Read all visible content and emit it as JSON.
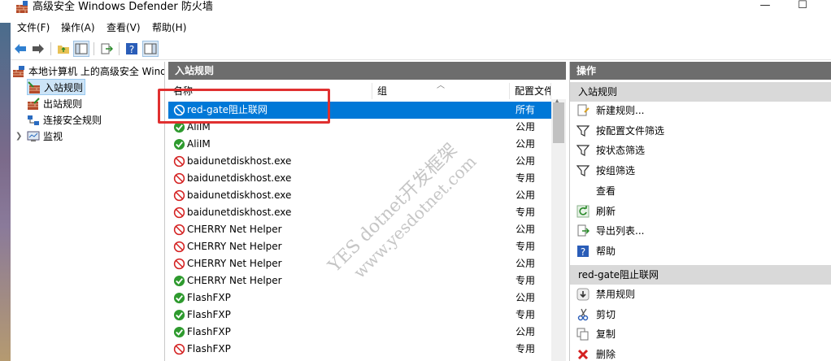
{
  "window": {
    "title": "高级安全 Windows Defender 防火墙",
    "minimize": "—",
    "maximize": "☐"
  },
  "menu": [
    "文件(F)",
    "操作(A)",
    "查看(V)",
    "帮助(H)"
  ],
  "tree": {
    "root": "本地计算机 上的高级安全 Wind",
    "items": [
      "入站规则",
      "出站规则",
      "连接安全规则",
      "监视"
    ]
  },
  "center": {
    "header": "入站规则",
    "columns": {
      "name": "名称",
      "group": "组",
      "profile": "配置文件"
    },
    "rows": [
      {
        "name": "red-gate阻止联网",
        "profile": "所有",
        "status": "blocked"
      },
      {
        "name": "AliIM",
        "profile": "公用",
        "status": "allowed"
      },
      {
        "name": "AliIM",
        "profile": "公用",
        "status": "allowed"
      },
      {
        "name": "baidunetdiskhost.exe",
        "profile": "公用",
        "status": "blocked"
      },
      {
        "name": "baidunetdiskhost.exe",
        "profile": "专用",
        "status": "blocked"
      },
      {
        "name": "baidunetdiskhost.exe",
        "profile": "公用",
        "status": "blocked"
      },
      {
        "name": "baidunetdiskhost.exe",
        "profile": "专用",
        "status": "blocked"
      },
      {
        "name": "CHERRY Net Helper",
        "profile": "公用",
        "status": "blocked"
      },
      {
        "name": "CHERRY Net Helper",
        "profile": "专用",
        "status": "blocked"
      },
      {
        "name": "CHERRY Net Helper",
        "profile": "公用",
        "status": "blocked"
      },
      {
        "name": "CHERRY Net Helper",
        "profile": "专用",
        "status": "allowed"
      },
      {
        "name": "FlashFXP",
        "profile": "公用",
        "status": "allowed"
      },
      {
        "name": "FlashFXP",
        "profile": "专用",
        "status": "allowed"
      },
      {
        "name": "FlashFXP",
        "profile": "公用",
        "status": "allowed"
      },
      {
        "name": "FlashFXP",
        "profile": "专用",
        "status": "blocked"
      }
    ]
  },
  "actions": {
    "header": "操作",
    "section1": "入站规则",
    "section1_items": [
      {
        "label": "新建规则...",
        "icon": "new-rule-icon"
      },
      {
        "label": "按配置文件筛选",
        "icon": "filter-icon"
      },
      {
        "label": "按状态筛选",
        "icon": "filter-icon"
      },
      {
        "label": "按组筛选",
        "icon": "filter-icon"
      },
      {
        "label": "查看",
        "icon": "view-icon"
      },
      {
        "label": "刷新",
        "icon": "refresh-icon"
      },
      {
        "label": "导出列表...",
        "icon": "export-icon"
      },
      {
        "label": "帮助",
        "icon": "help-icon"
      }
    ],
    "section2": "red-gate阻止联网",
    "section2_items": [
      {
        "label": "禁用规则",
        "icon": "disable-icon"
      },
      {
        "label": "剪切",
        "icon": "cut-icon"
      },
      {
        "label": "复制",
        "icon": "copy-icon"
      },
      {
        "label": "删除",
        "icon": "delete-icon"
      }
    ]
  },
  "watermark": {
    "line1": "YES dotnet开发框架",
    "line2": "www.yesdotnet.com"
  },
  "colors": {
    "selection": "#0078d7",
    "pane_header": "#6d6d6d",
    "allowed": "#2e9a2e",
    "blocked": "#d42020"
  }
}
